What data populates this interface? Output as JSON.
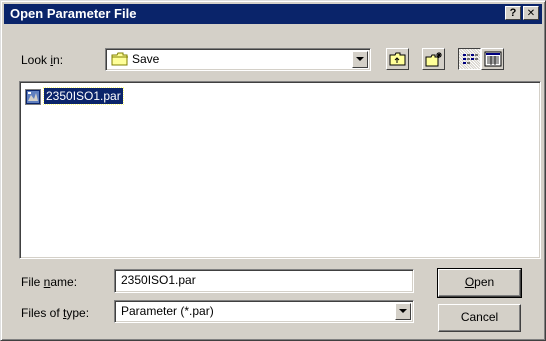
{
  "window": {
    "title": "Open Parameter File",
    "help_glyph": "?",
    "close_glyph": "✕"
  },
  "look_in": {
    "label_pre": "Look ",
    "label_accel": "i",
    "label_post": "n:",
    "value": "Save",
    "icon": "folder-icon"
  },
  "toolbar": {
    "buttons": [
      {
        "name": "up-one-level",
        "icon": "folder-up-icon"
      },
      {
        "name": "create-new-folder",
        "icon": "new-folder-icon"
      },
      {
        "name": "list-view",
        "icon": "list-view-icon",
        "pressed": true
      },
      {
        "name": "details-view",
        "icon": "details-view-icon",
        "pressed": false
      }
    ]
  },
  "file_list": {
    "items": [
      {
        "name": "2350ISO1.par",
        "icon": "parameter-file-icon",
        "selected": true
      }
    ]
  },
  "file_name": {
    "label_pre": "File ",
    "label_accel": "n",
    "label_post": "ame:",
    "value": "2350ISO1.par"
  },
  "file_type": {
    "label_pre": "Files of ",
    "label_accel": "t",
    "label_post": "ype:",
    "value": "Parameter (*.par)"
  },
  "buttons": {
    "open_accel": "O",
    "open_rest": "pen",
    "cancel": "Cancel"
  },
  "colors": {
    "title_bar": "#0a246a",
    "face": "#d4d0c8",
    "selection": "#0a246a"
  }
}
